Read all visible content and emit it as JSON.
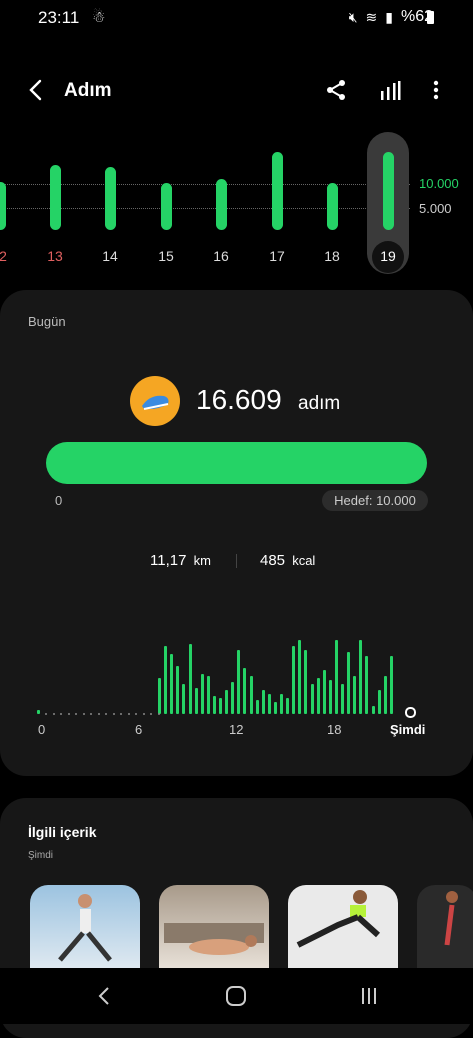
{
  "status": {
    "time": "23:11",
    "battery": "%62"
  },
  "header": {
    "title": "Adım"
  },
  "week": {
    "days": [
      "2",
      "13",
      "14",
      "15",
      "16",
      "17",
      "18",
      "19"
    ],
    "selected_day": "19",
    "y_labels": [
      "10.000",
      "5.000"
    ]
  },
  "today": {
    "label": "Bugün",
    "steps": "16.609",
    "steps_unit": "adım",
    "progress_start": "0",
    "goal": "Hedef: 10.000",
    "progress_fraction": 1.0,
    "distance_value": "11,17",
    "distance_unit": "km",
    "calories_value": "485",
    "calories_unit": "kcal",
    "hour_labels": [
      "0",
      "6",
      "12",
      "18",
      "Şimdi"
    ]
  },
  "related": {
    "title": "İlgili içerik",
    "subtitle": "Şimdi"
  },
  "colors": {
    "accent": "#25d366",
    "card": "#171717",
    "badge": "#f5a623"
  }
}
